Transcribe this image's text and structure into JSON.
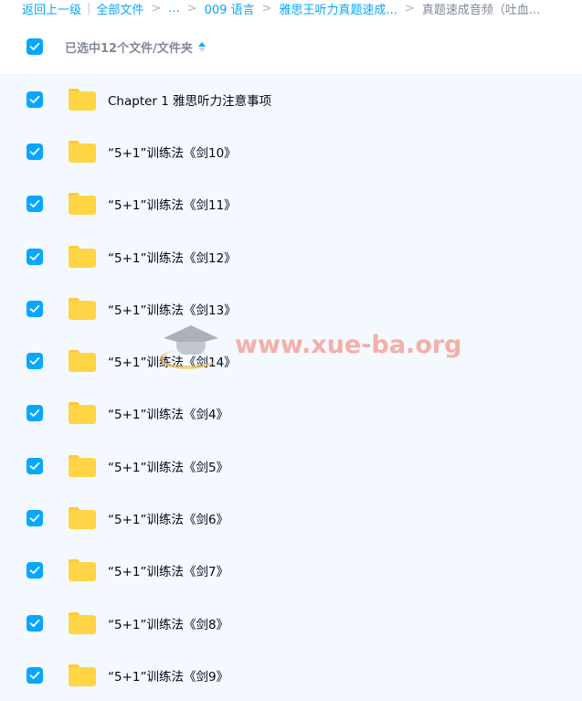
{
  "breadcrumb": {
    "back": "返回上一级",
    "all_files": "全部文件",
    "ellipsis": "...",
    "item1": "009 语言",
    "item2": "雅思王听力真题速成...",
    "current": "真题速成音频（吐血..."
  },
  "header": {
    "selected_text": "已选中12个文件/文件夹"
  },
  "folders": [
    {
      "name": "Chapter 1 雅思听力注意事项"
    },
    {
      "name": "“5+1”训练法《剑10》"
    },
    {
      "name": "“5+1”训练法《剑11》"
    },
    {
      "name": "“5+1”训练法《剑12》"
    },
    {
      "name": "“5+1”训练法《剑13》"
    },
    {
      "name": "“5+1”训练法《剑14》"
    },
    {
      "name": "“5+1”训练法《剑4》"
    },
    {
      "name": "“5+1”训练法《剑5》"
    },
    {
      "name": "“5+1”训练法《剑6》"
    },
    {
      "name": "“5+1”训练法《剑7》"
    },
    {
      "name": "“5+1”训练法《剑8》"
    },
    {
      "name": "“5+1”训练法《剑9》"
    }
  ],
  "watermark": {
    "text": "www.xue-ba.org",
    "icon": "graduation-cap-icon"
  },
  "colors": {
    "accent": "#06a7ff",
    "list_background": "#f3f9fe",
    "folder": "#ffd545",
    "watermark_text": "#f3a7a0"
  }
}
